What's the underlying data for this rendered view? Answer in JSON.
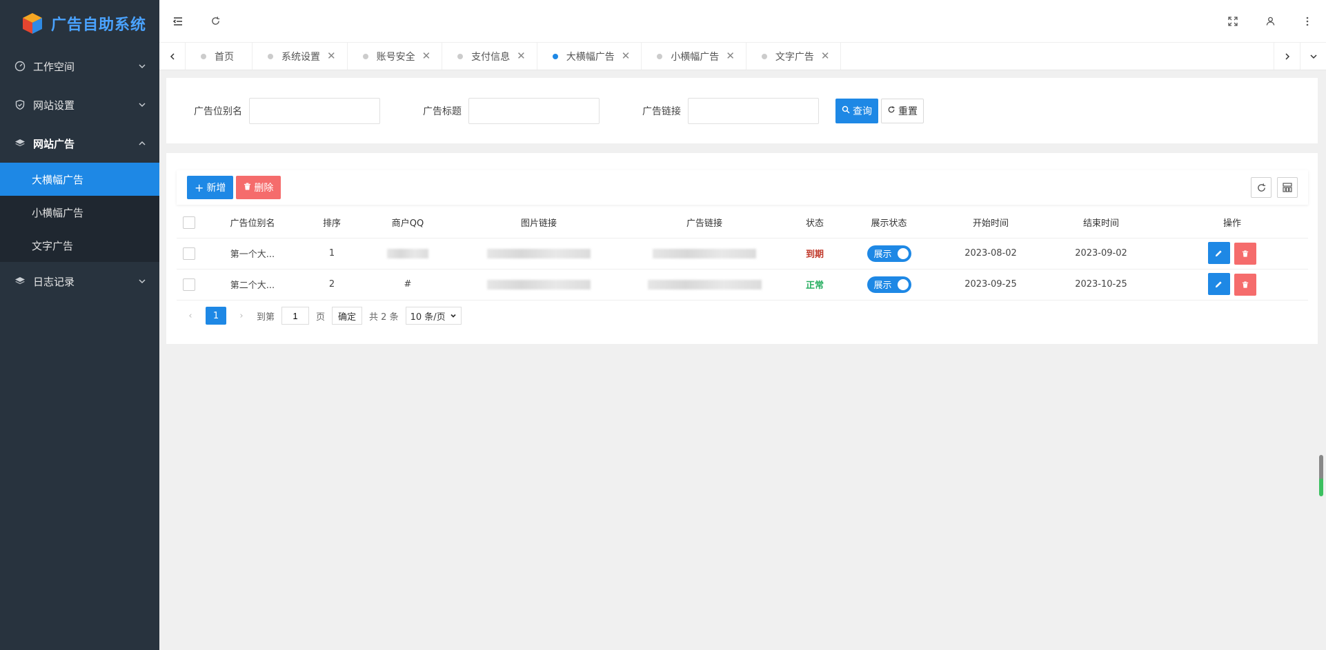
{
  "app": {
    "title": "广告自助系统"
  },
  "sidebar": {
    "groups": [
      {
        "label": "工作空间",
        "icon": "dashboard-icon",
        "open": false
      },
      {
        "label": "网站设置",
        "icon": "shield-icon",
        "open": false
      },
      {
        "label": "网站广告",
        "icon": "layers-icon",
        "open": true,
        "items": [
          {
            "label": "大横幅广告",
            "active": true
          },
          {
            "label": "小横幅广告",
            "active": false
          },
          {
            "label": "文字广告",
            "active": false
          }
        ]
      },
      {
        "label": "日志记录",
        "icon": "layers-icon",
        "open": false
      }
    ]
  },
  "tabs": [
    {
      "label": "首页",
      "active": false,
      "closable": false
    },
    {
      "label": "系统设置",
      "active": false,
      "closable": true
    },
    {
      "label": "账号安全",
      "active": false,
      "closable": true
    },
    {
      "label": "支付信息",
      "active": false,
      "closable": true
    },
    {
      "label": "大横幅广告",
      "active": true,
      "closable": true
    },
    {
      "label": "小横幅广告",
      "active": false,
      "closable": true
    },
    {
      "label": "文字广告",
      "active": false,
      "closable": true
    }
  ],
  "search": {
    "fields": [
      {
        "label": "广告位别名",
        "value": ""
      },
      {
        "label": "广告标题",
        "value": ""
      },
      {
        "label": "广告链接",
        "value": ""
      }
    ],
    "query_label": "查询",
    "reset_label": "重置"
  },
  "toolbar": {
    "add_label": "新增",
    "delete_label": "删除"
  },
  "table": {
    "headers": [
      "广告位别名",
      "排序",
      "商户QQ",
      "图片链接",
      "广告链接",
      "状态",
      "展示状态",
      "开始时间",
      "结束时间",
      "操作"
    ],
    "rows": [
      {
        "alias": "第一个大...",
        "sort": "1",
        "qq": "",
        "image_link": "",
        "ad_link": "",
        "status": "到期",
        "status_type": "expired",
        "display": "展示",
        "start": "2023-08-02",
        "end": "2023-09-02"
      },
      {
        "alias": "第二个大...",
        "sort": "2",
        "qq": "#",
        "image_link": "",
        "ad_link": "",
        "status": "正常",
        "status_type": "normal",
        "display": "展示",
        "start": "2023-09-25",
        "end": "2023-10-25"
      }
    ]
  },
  "pagination": {
    "current": "1",
    "goto_prefix": "到第",
    "goto_value": "1",
    "goto_suffix": "页",
    "confirm_label": "确定",
    "total_text": "共 2 条",
    "page_size": "10 条/页"
  },
  "colors": {
    "primary": "#1e88e5",
    "danger": "#f56c6c",
    "sidebar": "#28333e",
    "expired": "#c0392b",
    "normal": "#27ae60"
  }
}
